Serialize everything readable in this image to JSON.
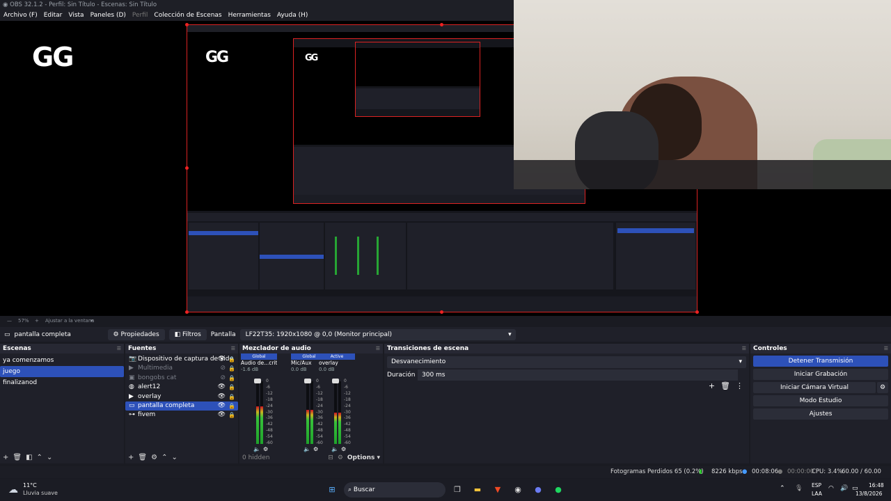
{
  "window": {
    "title": "OBS 32.1.2 - Perfil: Sin Título - Escenas: Sin Título"
  },
  "menu": [
    "Archivo (F)",
    "Editar",
    "Vista",
    "Paneles (D)",
    "Perfil",
    "Colección de Escenas",
    "Herramientas",
    "Ayuda (H)"
  ],
  "preview": {
    "logo_text": "GG",
    "zoom": "57%",
    "zoom_fit_label": "Ajustar a la ventana"
  },
  "source_toolbar": {
    "source_name": "pantalla completa",
    "properties_label": "Propiedades",
    "filters_label": "Filtros",
    "display_label": "Pantalla",
    "display_value": "LF22T35: 1920x1080 @ 0,0 (Monitor principal)"
  },
  "scenes": {
    "title": "Escenas",
    "items": [
      "ya comenzamos",
      "juego",
      "finalizanod"
    ],
    "selected_index": 1
  },
  "sources": {
    "title": "Fuentes",
    "items": [
      {
        "label": "Dispositivo de captura de vide",
        "icon": "camera-icon",
        "visible": true
      },
      {
        "label": "Multimedia",
        "icon": "play-icon",
        "visible": false
      },
      {
        "label": "bongobs cat",
        "icon": "image-icon",
        "visible": false
      },
      {
        "label": "alert12",
        "icon": "globe-icon",
        "visible": true
      },
      {
        "label": "overlay",
        "icon": "play-icon",
        "visible": true
      },
      {
        "label": "pantalla completa",
        "icon": "monitor-icon",
        "visible": true
      },
      {
        "label": "fivem",
        "icon": "gamepad-icon",
        "visible": true
      }
    ],
    "selected_index": 5
  },
  "mixer": {
    "title": "Mezclador de audio",
    "channels": [
      {
        "tab": "Global",
        "name": "Audio de...critorio",
        "db": "-1.6 dB",
        "level": 0.6
      },
      {
        "tab": "Global",
        "name": "Mic/Aux",
        "db": "0.0 dB",
        "level": 0.55
      },
      {
        "tab": "Active",
        "name": "overlay",
        "db": "0.0 dB",
        "level": 0.5
      }
    ],
    "scale": [
      "0",
      "-6",
      "-12",
      "-18",
      "-24",
      "-30",
      "-36",
      "-42",
      "-48",
      "-54",
      "-60"
    ],
    "hidden_label": "0 hidden",
    "options_label": "Options"
  },
  "transitions": {
    "title": "Transiciones de escena",
    "transition": "Desvanecimiento",
    "duration_label": "Duración",
    "duration_value": "300 ms"
  },
  "controls": {
    "title": "Controles",
    "buttons": [
      "Detener Transmisión",
      "Iniciar Grabación",
      "Iniciar Cámara Virtual",
      "Modo Estudio",
      "Ajustes"
    ]
  },
  "status": {
    "dropped_frames": "Fotogramas Perdidos 65 (0.2%)",
    "bitrate": "8226 kbps",
    "stream_time": "00:08:06",
    "rec_time": "00:00:00",
    "cpu": "CPU: 3.4%",
    "fps": "60.00 / 60.00 FPS"
  },
  "taskbar": {
    "weather_temp": "11°C",
    "weather_desc": "Lluvia suave",
    "search_label": "Buscar",
    "lang_top": "ESP",
    "lang_bottom": "LAA",
    "time": "16:48",
    "date": "13/8/2026"
  },
  "colors": {
    "accent": "#2d51b9",
    "panel": "#1f2029",
    "border_red": "#dd2222"
  }
}
